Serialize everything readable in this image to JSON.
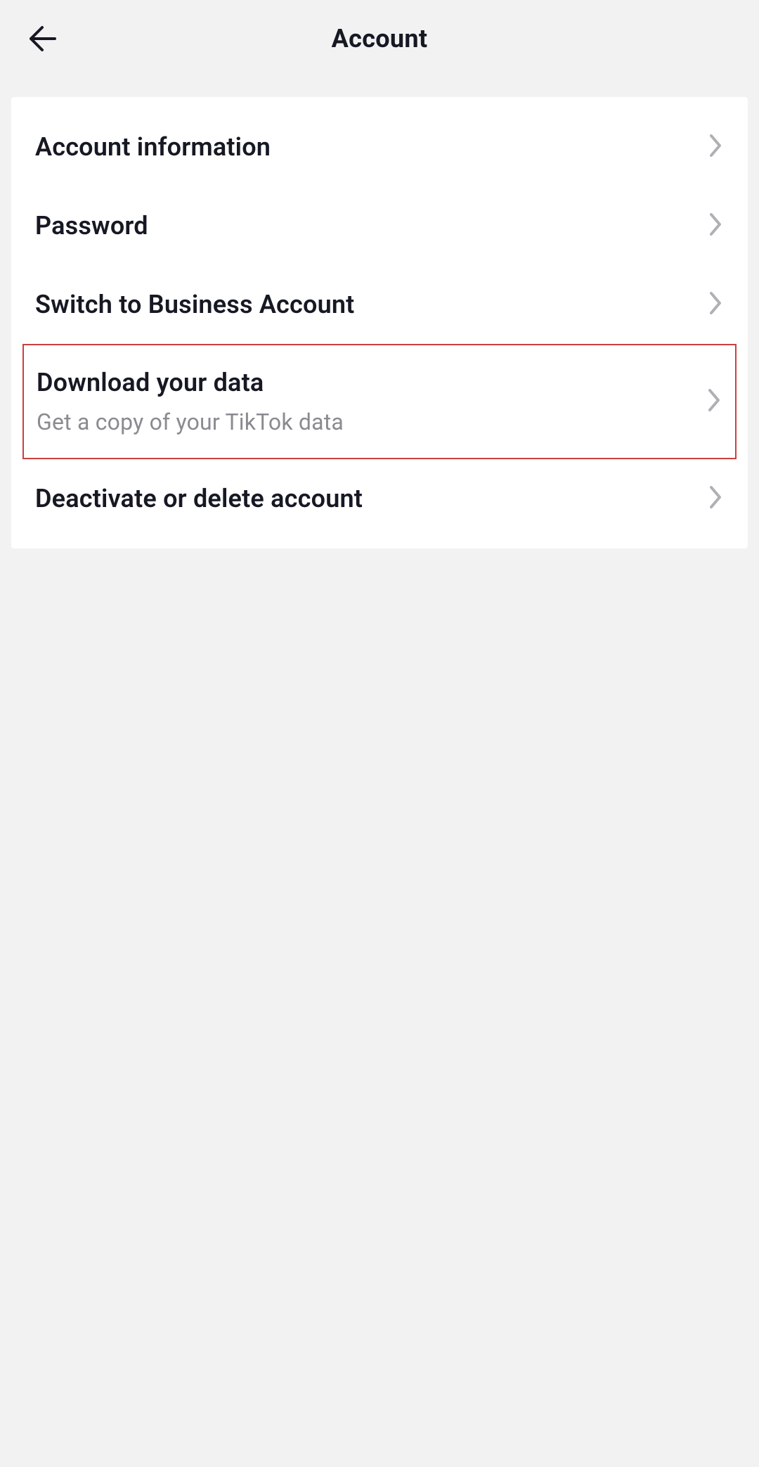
{
  "header": {
    "title": "Account"
  },
  "items": [
    {
      "label": "Account information",
      "subtitle": null,
      "highlighted": false
    },
    {
      "label": "Password",
      "subtitle": null,
      "highlighted": false
    },
    {
      "label": "Switch to Business Account",
      "subtitle": null,
      "highlighted": false
    },
    {
      "label": "Download your data",
      "subtitle": "Get a copy of your TikTok data",
      "highlighted": true
    },
    {
      "label": "Deactivate or delete account",
      "subtitle": null,
      "highlighted": false
    }
  ]
}
